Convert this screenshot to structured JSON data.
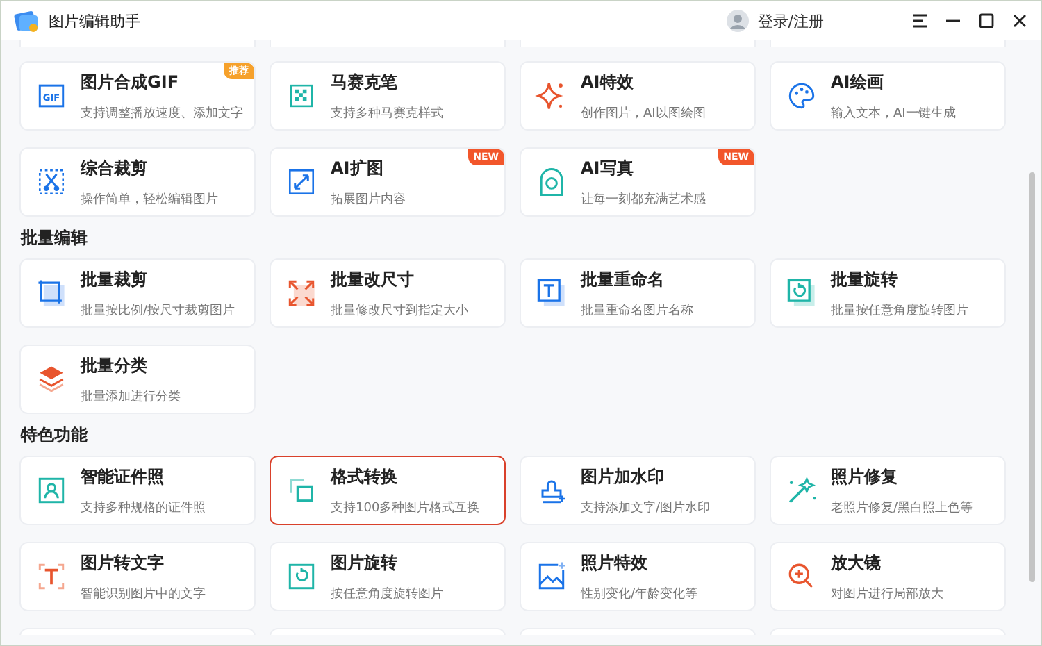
{
  "window": {
    "title": "图片编辑助手",
    "login": "登录/注册"
  },
  "sections": [
    {
      "items": [
        {
          "title": "图片合成GIF",
          "icon_label": "GIF",
          "desc": "支持调整播放速度、添加文字",
          "badge": {
            "text": "推荐",
            "kind": "recommend"
          },
          "selected": false
        },
        {
          "title": "马赛克笔",
          "desc": "支持多种马赛克样式",
          "selected": false
        },
        {
          "title": "AI特效",
          "desc": "创作图片，AI以图绘图",
          "selected": false
        },
        {
          "title": "AI绘画",
          "desc": "输入文本，AI一键生成",
          "selected": false
        },
        {
          "title": "综合裁剪",
          "desc": "操作简单，轻松编辑图片",
          "selected": false
        },
        {
          "title": "AI扩图",
          "desc": "拓展图片内容",
          "badge": {
            "text": "NEW",
            "kind": "new"
          },
          "selected": false
        },
        {
          "title": "AI写真",
          "desc": "让每一刻都充满艺术感",
          "badge": {
            "text": "NEW",
            "kind": "new"
          },
          "selected": false
        }
      ]
    },
    {
      "heading": "批量编辑",
      "items": [
        {
          "title": "批量裁剪",
          "desc": "批量按比例/按尺寸裁剪图片",
          "selected": false
        },
        {
          "title": "批量改尺寸",
          "desc": "批量修改尺寸到指定大小",
          "selected": false
        },
        {
          "title": "批量重命名",
          "desc": "批量重命名图片名称",
          "selected": false
        },
        {
          "title": "批量旋转",
          "desc": "批量按任意角度旋转图片",
          "selected": false
        },
        {
          "title": "批量分类",
          "desc": "批量添加进行分类",
          "selected": false
        }
      ]
    },
    {
      "heading": "特色功能",
      "items": [
        {
          "title": "智能证件照",
          "desc": "支持多种规格的证件照",
          "selected": false
        },
        {
          "title": "格式转换",
          "desc": "支持100多种图片格式互换",
          "selected": true
        },
        {
          "title": "图片加水印",
          "desc": "支持添加文字/图片水印",
          "selected": false
        },
        {
          "title": "照片修复",
          "desc": "老照片修复/黑白照上色等",
          "selected": false
        },
        {
          "title": "图片转文字",
          "desc": "智能识别图片中的文字",
          "selected": false
        },
        {
          "title": "图片旋转",
          "desc": "按任意角度旋转图片",
          "selected": false
        },
        {
          "title": "照片特效",
          "desc": "性别变化/年龄变化等",
          "selected": false
        },
        {
          "title": "放大镜",
          "desc": "对图片进行局部放大",
          "selected": false
        }
      ]
    }
  ]
}
